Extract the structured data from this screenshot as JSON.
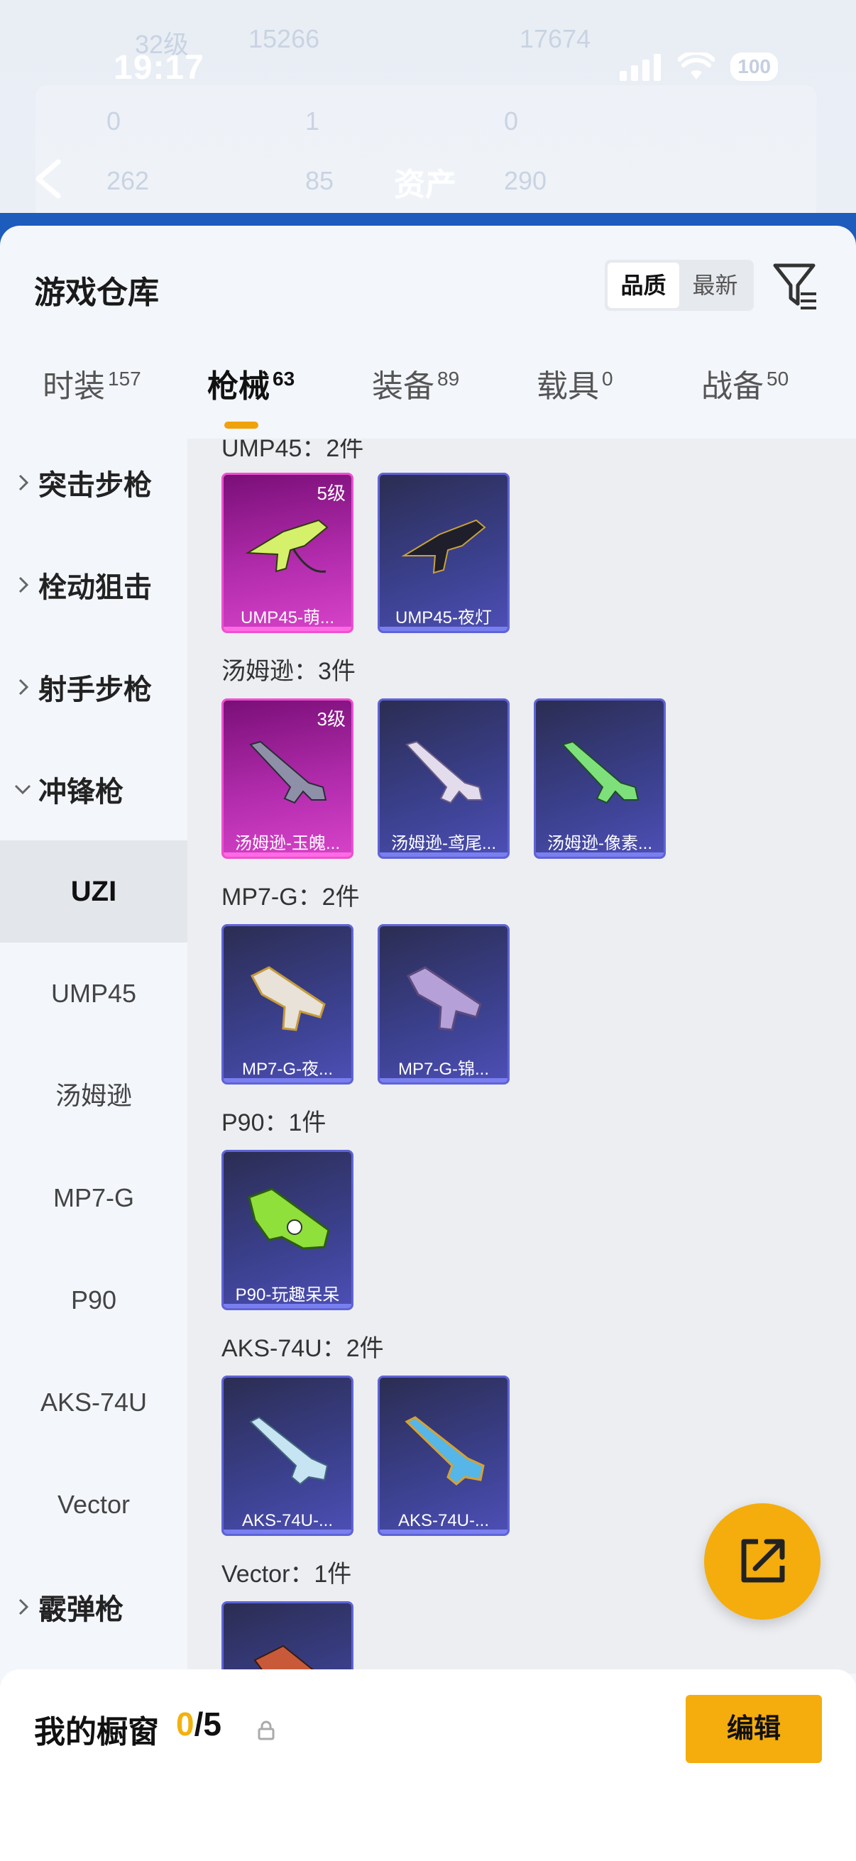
{
  "status": {
    "time": "19:17",
    "battery": "100"
  },
  "header": {
    "title": "资产",
    "ghost": {
      "level": "32级",
      "coins": "15266",
      "other": "17674",
      "s1": "0",
      "s2": "1",
      "s3": "0",
      "s4": "262",
      "s5": "85",
      "s6": "290"
    }
  },
  "sheet": {
    "title": "游戏仓库",
    "sort": [
      "品质",
      "最新"
    ],
    "tabs": [
      {
        "label": "时装",
        "count": "157"
      },
      {
        "label": "枪械",
        "count": "63"
      },
      {
        "label": "装备",
        "count": "89"
      },
      {
        "label": "载具",
        "count": "0"
      },
      {
        "label": "战备",
        "count": "50"
      }
    ]
  },
  "categories": {
    "assault": "突击步枪",
    "bolt": "栓动狙击",
    "marksman": "射手步枪",
    "smg": "冲锋枪",
    "shotgun": "霰弹枪"
  },
  "subs": [
    "UZI",
    "UMP45",
    "汤姆逊",
    "MP7-G",
    "P90",
    "AKS-74U",
    "Vector"
  ],
  "groups": [
    {
      "label": "UMP45：2件",
      "items": [
        {
          "name": "UMP45-萌...",
          "level": "5级",
          "rarity": "purple"
        },
        {
          "name": "UMP45-夜灯",
          "level": "",
          "rarity": "blue"
        }
      ]
    },
    {
      "label": "汤姆逊：3件",
      "items": [
        {
          "name": "汤姆逊-玉魄...",
          "level": "3级",
          "rarity": "purple"
        },
        {
          "name": "汤姆逊-鸢尾...",
          "level": "",
          "rarity": "blue"
        },
        {
          "name": "汤姆逊-像素...",
          "level": "",
          "rarity": "blue"
        }
      ]
    },
    {
      "label": "MP7-G：2件",
      "items": [
        {
          "name": "MP7-G-夜...",
          "level": "",
          "rarity": "blue"
        },
        {
          "name": "MP7-G-锦...",
          "level": "",
          "rarity": "blue"
        }
      ]
    },
    {
      "label": "P90：1件",
      "items": [
        {
          "name": "P90-玩趣呆呆",
          "level": "",
          "rarity": "blue"
        }
      ]
    },
    {
      "label": "AKS-74U：2件",
      "items": [
        {
          "name": "AKS-74U-...",
          "level": "",
          "rarity": "blue"
        },
        {
          "name": "AKS-74U-...",
          "level": "",
          "rarity": "blue"
        }
      ]
    },
    {
      "label": "Vector：1件",
      "items": []
    }
  ],
  "bottom": {
    "label": "我的橱窗",
    "current": "0",
    "total": "/5",
    "edit": "编辑"
  },
  "colors": {
    "accent": "#f4ad0d",
    "purple_border": "#f04fd1",
    "blue_border": "#5f63d6"
  }
}
